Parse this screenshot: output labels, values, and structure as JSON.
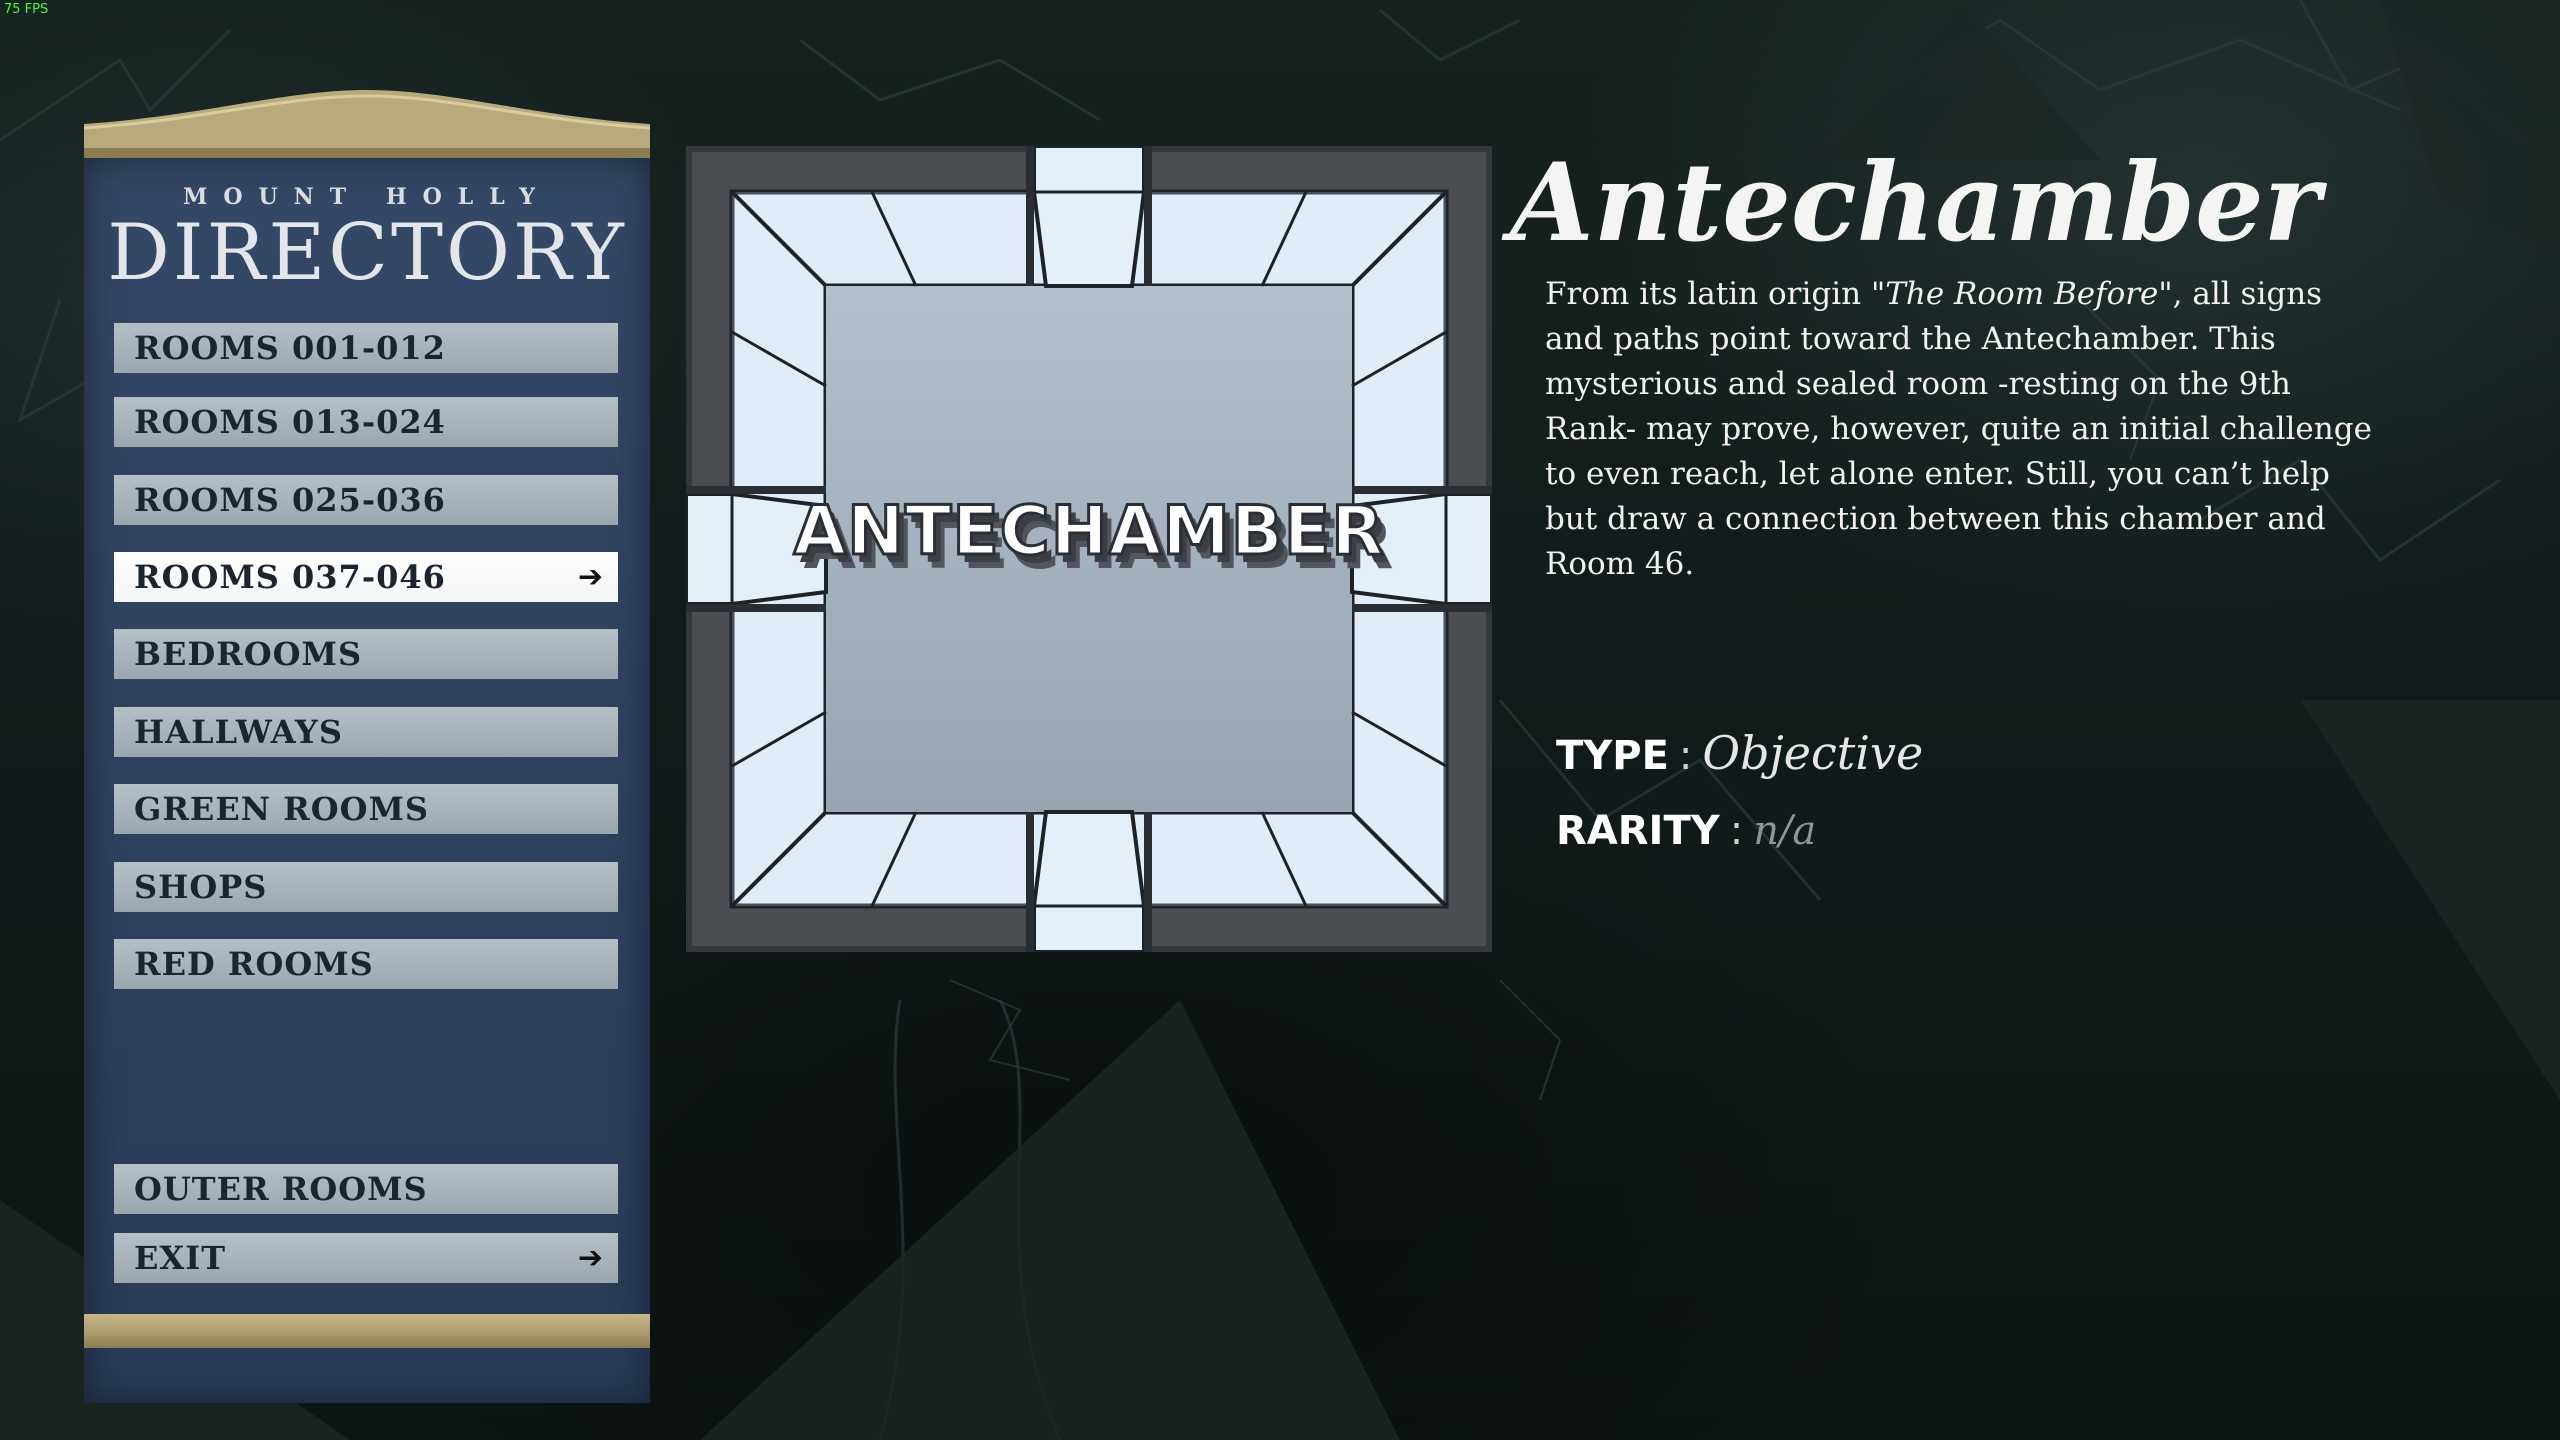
{
  "hud": {
    "fps": "75 FPS"
  },
  "directory": {
    "subtitle": "MOUNT HOLLY",
    "title": "DIRECTORY",
    "items": [
      {
        "label": "ROOMS 001-012",
        "active": false,
        "arrow": ""
      },
      {
        "label": "ROOMS 013-024",
        "active": false,
        "arrow": ""
      },
      {
        "label": "ROOMS 025-036",
        "active": false,
        "arrow": ""
      },
      {
        "label": "ROOMS 037-046",
        "active": true,
        "arrow": "➔"
      },
      {
        "label": "BEDROOMS",
        "active": false,
        "arrow": ""
      },
      {
        "label": "HALLWAYS",
        "active": false,
        "arrow": ""
      },
      {
        "label": "GREEN ROOMS",
        "active": false,
        "arrow": ""
      },
      {
        "label": "SHOPS",
        "active": false,
        "arrow": ""
      },
      {
        "label": "RED ROOMS",
        "active": false,
        "arrow": ""
      },
      {
        "label": "OUTER ROOMS",
        "active": false,
        "arrow": ""
      },
      {
        "label": "EXIT",
        "active": false,
        "arrow": "➔"
      }
    ],
    "arrow_icon": "right-arrow-icon"
  },
  "room": {
    "tile_label": "ANTECHAMBER",
    "name": "Antechamber",
    "description": {
      "part1": "From its latin origin ",
      "quote": "\"The Room Before\"",
      "part2": ", all signs and paths point toward the Antechamber. This mysterious and sealed room -resting on the 9th Rank- may prove, however, quite an initial challenge to even reach, let alone enter. Still, you can’t help but draw a connection between this chamber and Room 46."
    },
    "type_label": "TYPE",
    "type_value": "Objective",
    "rarity_label": "RARITY",
    "rarity_value": "n/a",
    "colon": ":"
  },
  "colors": {
    "panel_blue": "#2b4160",
    "panel_trim": "#c7b788",
    "button_idle": "#a8b3bb",
    "button_active": "#ffffff",
    "tile_glass": "#e8f2fa",
    "tile_floor": "#a4b1bd",
    "tile_frame": "#4a4e53"
  }
}
